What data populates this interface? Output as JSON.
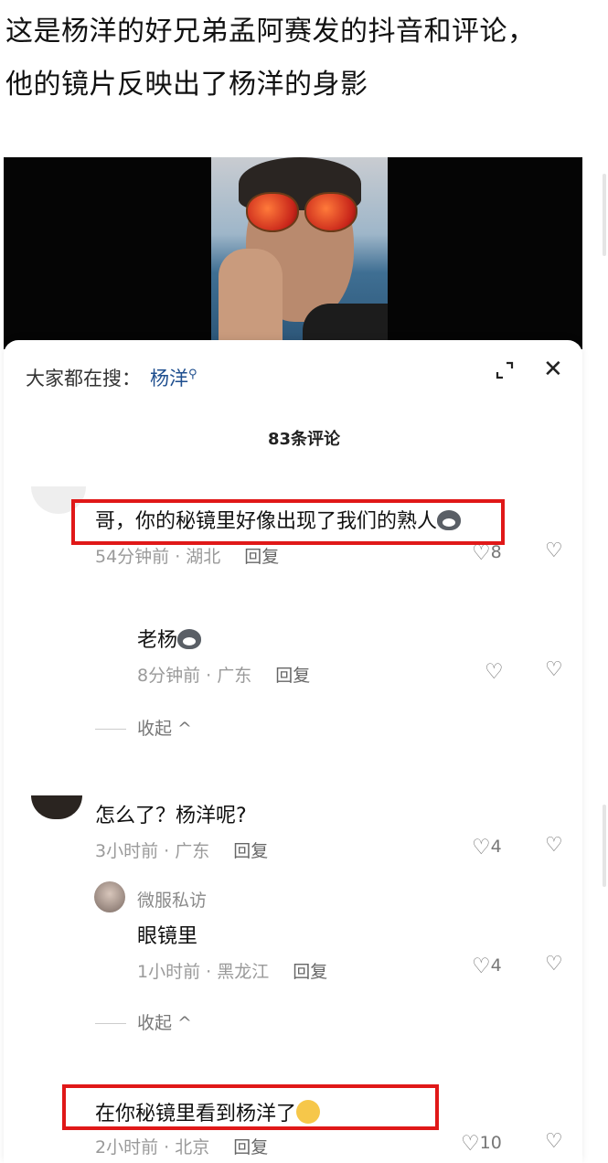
{
  "caption": {
    "line1": "这是杨洋的好兄弟孟阿赛发的抖音和评论，",
    "line2": "他的镜片反映出了杨洋的身影"
  },
  "search": {
    "label": "大家都在搜：",
    "keyword": "杨洋",
    "icon": "search-icon"
  },
  "header": {
    "count": "83条评论"
  },
  "comments": [
    {
      "text": "哥，你的秘镜里好像出现了我们的熟人",
      "meta": "54分钟前 · 湖北",
      "reply": "回复",
      "likes": "8"
    },
    {
      "text": "老杨",
      "meta": "8分钟前 · 广东",
      "reply": "回复",
      "likes": ""
    },
    {
      "text": "怎么了？杨洋呢?",
      "meta": "3小时前 · 广东",
      "reply": "回复",
      "likes": "4"
    },
    {
      "user": "微服私访",
      "text": "眼镜里",
      "meta": "1小时前 · 黑龙江",
      "reply": "回复",
      "likes": "4"
    },
    {
      "text": "在你秘镜里看到杨洋了",
      "meta": "2小时前 · 北京",
      "reply": "回复",
      "likes": "10"
    }
  ],
  "collapse_label": "收起 ^",
  "colors": {
    "highlight": "#e01818",
    "search_keyword": "#1f4f8f"
  }
}
